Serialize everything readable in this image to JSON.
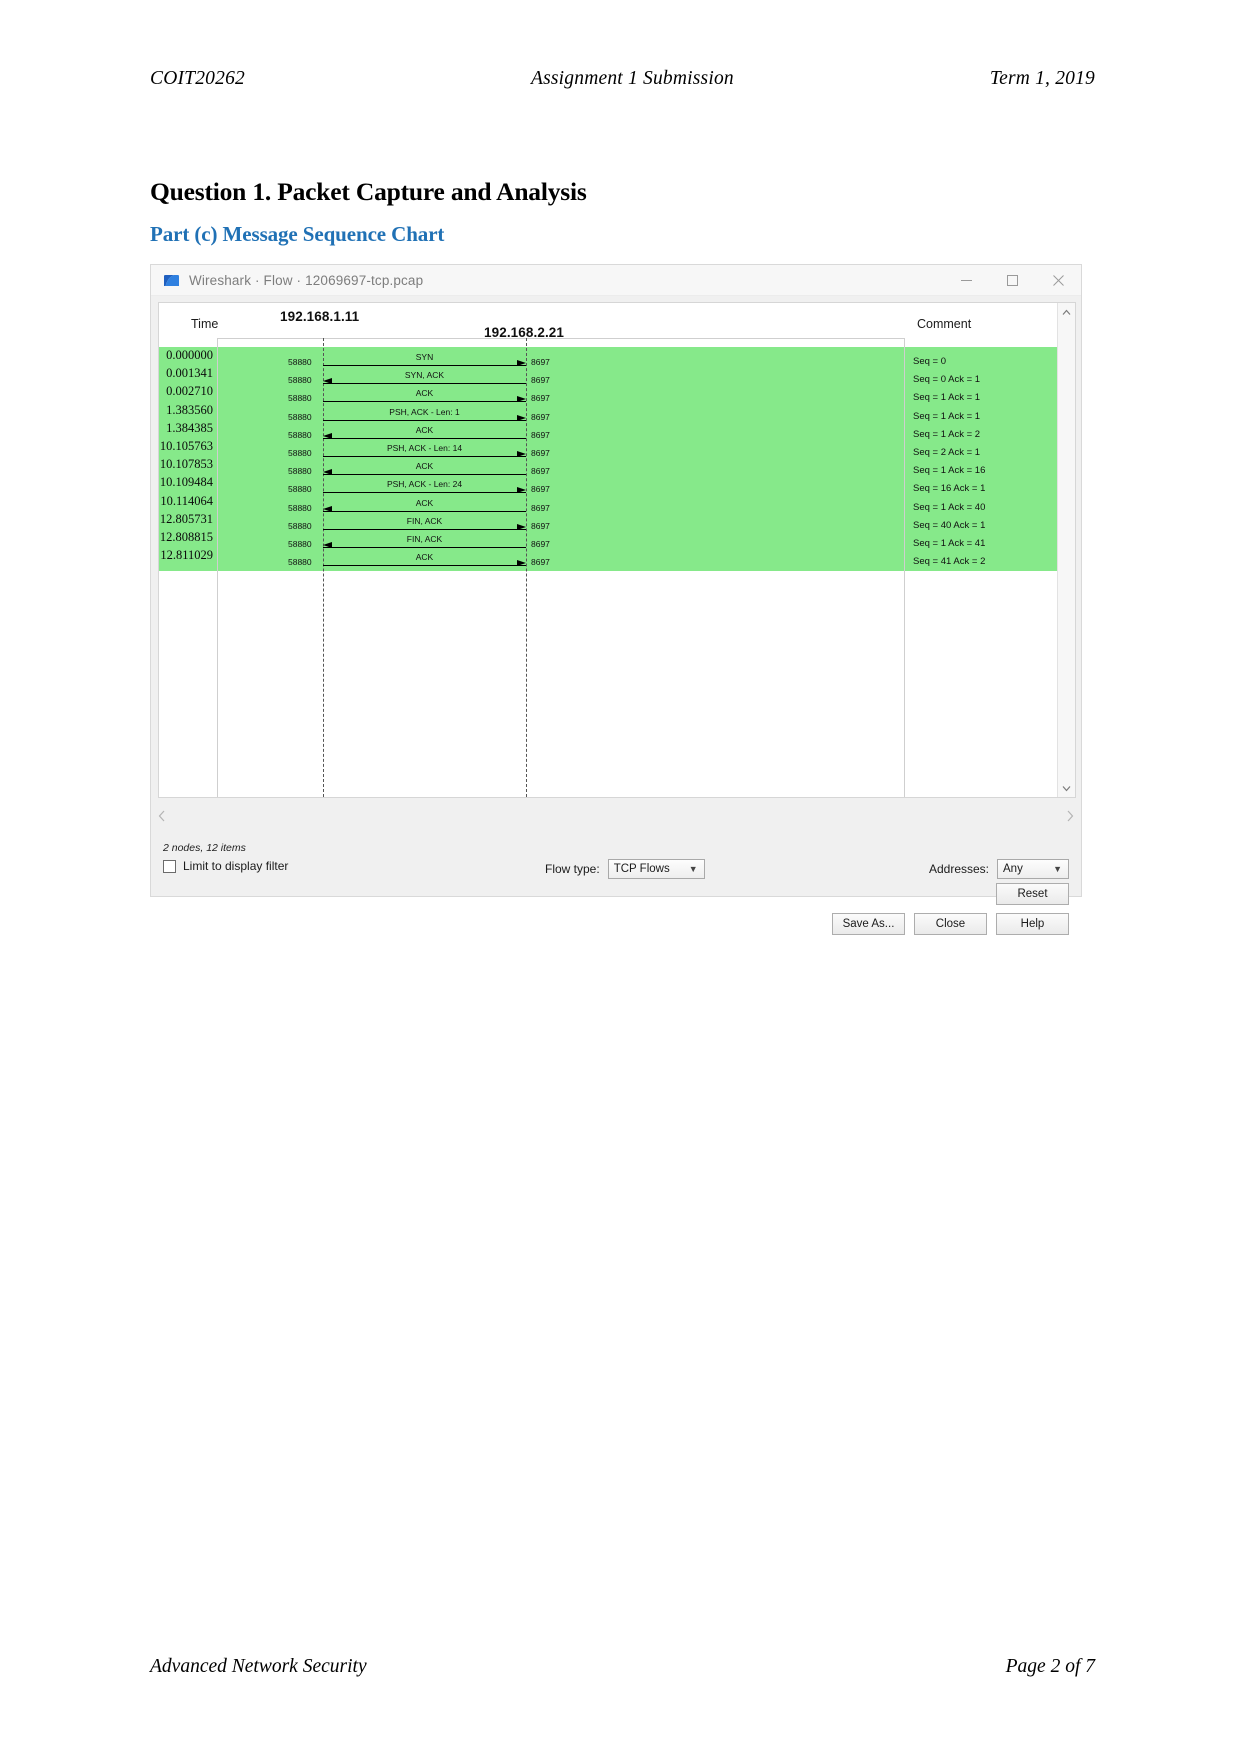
{
  "document": {
    "header": {
      "left": "COIT20262",
      "center": "Assignment 1 Submission",
      "right": "Term 1, 2019"
    },
    "footer": {
      "left": "Advanced Network Security",
      "right": "Page 2 of 7"
    },
    "question_title": "Question 1. Packet Capture and Analysis",
    "part_title": "Part (c) Message Sequence Chart",
    "accent_color": "#2071b5"
  },
  "window": {
    "title": "Wireshark · Flow · 12069697-tcp.pcap",
    "minimize_label": "—",
    "maximize_label": "□",
    "close_label": "✕"
  },
  "diagram": {
    "columns": {
      "time": "Time",
      "comment": "Comment"
    },
    "nodes": [
      {
        "address": "192.168.1.11",
        "port": "58880"
      },
      {
        "address": "192.168.2.21",
        "port": "8697"
      }
    ],
    "highlight_color": "#86e98a",
    "status": "2 nodes, 12 items",
    "messages": [
      {
        "time": "0.000000",
        "src_port": "58880",
        "dst_port": "8697",
        "label": "SYN",
        "direction": "right",
        "comment": "Seq = 0"
      },
      {
        "time": "0.001341",
        "src_port": "58880",
        "dst_port": "8697",
        "label": "SYN, ACK",
        "direction": "left",
        "comment": "Seq = 0 Ack = 1"
      },
      {
        "time": "0.002710",
        "src_port": "58880",
        "dst_port": "8697",
        "label": "ACK",
        "direction": "right",
        "comment": "Seq = 1 Ack = 1"
      },
      {
        "time": "1.383560",
        "src_port": "58880",
        "dst_port": "8697",
        "label": "PSH, ACK - Len: 1",
        "direction": "right",
        "comment": "Seq = 1 Ack = 1"
      },
      {
        "time": "1.384385",
        "src_port": "58880",
        "dst_port": "8697",
        "label": "ACK",
        "direction": "left",
        "comment": "Seq = 1 Ack = 2"
      },
      {
        "time": "10.105763",
        "src_port": "58880",
        "dst_port": "8697",
        "label": "PSH, ACK - Len: 14",
        "direction": "right",
        "comment": "Seq = 2 Ack = 1"
      },
      {
        "time": "10.107853",
        "src_port": "58880",
        "dst_port": "8697",
        "label": "ACK",
        "direction": "left",
        "comment": "Seq = 1 Ack = 16"
      },
      {
        "time": "10.109484",
        "src_port": "58880",
        "dst_port": "8697",
        "label": "PSH, ACK - Len: 24",
        "direction": "right",
        "comment": "Seq = 16 Ack = 1"
      },
      {
        "time": "10.114064",
        "src_port": "58880",
        "dst_port": "8697",
        "label": "ACK",
        "direction": "left",
        "comment": "Seq = 1 Ack = 40"
      },
      {
        "time": "12.805731",
        "src_port": "58880",
        "dst_port": "8697",
        "label": "FIN, ACK",
        "direction": "right",
        "comment": "Seq = 40 Ack = 1"
      },
      {
        "time": "12.808815",
        "src_port": "58880",
        "dst_port": "8697",
        "label": "FIN, ACK",
        "direction": "left",
        "comment": "Seq = 1 Ack = 41"
      },
      {
        "time": "12.811029",
        "src_port": "58880",
        "dst_port": "8697",
        "label": "ACK",
        "direction": "right",
        "comment": "Seq = 41 Ack = 2"
      }
    ]
  },
  "controls": {
    "limit_checkbox_label": "Limit to display filter",
    "limit_checkbox_checked": false,
    "flow_type_label": "Flow type:",
    "flow_type_value": "TCP Flows",
    "addresses_label": "Addresses:",
    "addresses_value": "Any",
    "reset_label": "Reset",
    "save_as_label": "Save As...",
    "close_label": "Close",
    "help_label": "Help"
  }
}
